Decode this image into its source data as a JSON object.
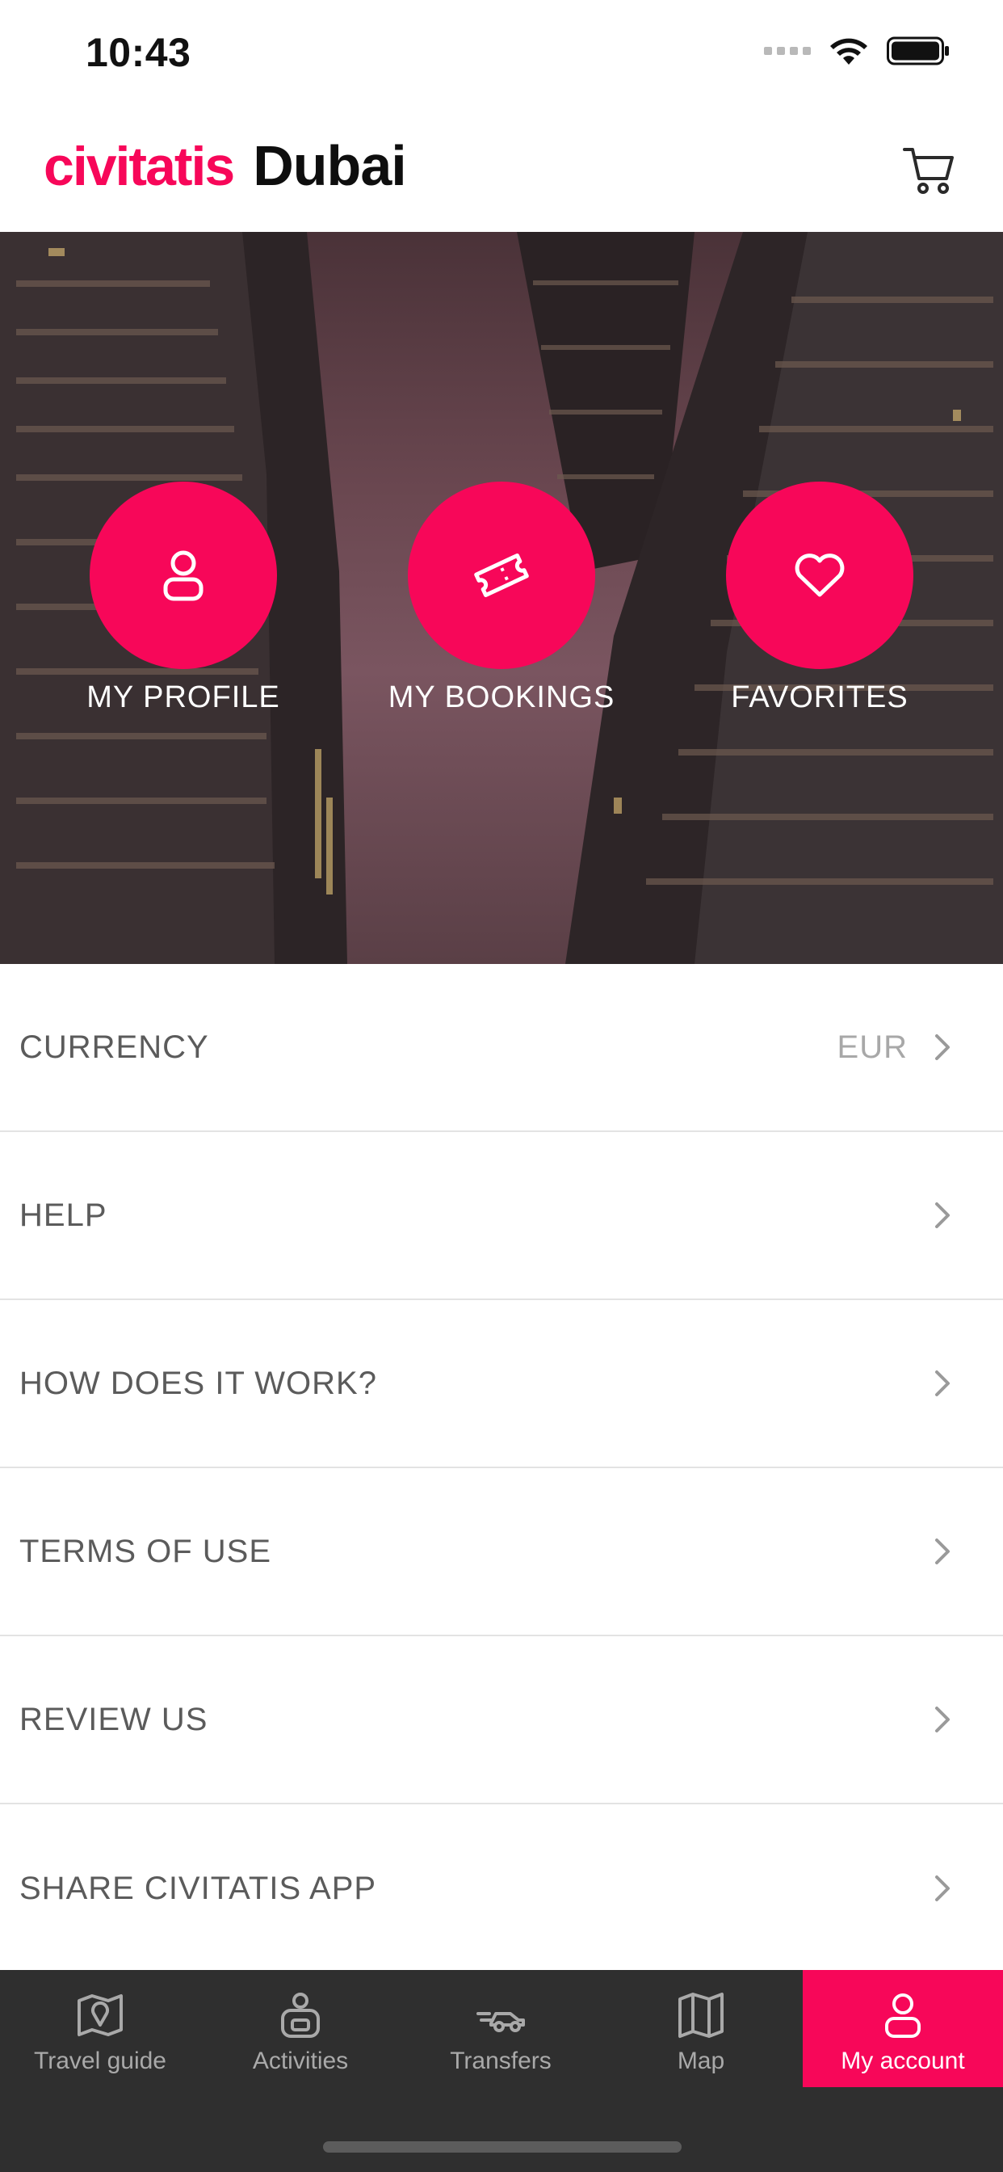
{
  "status_bar": {
    "time": "10:43"
  },
  "header": {
    "brand": "civitatis",
    "city": "Dubai"
  },
  "quick_actions": [
    {
      "label": "MY PROFILE",
      "icon": "user-icon"
    },
    {
      "label": "MY BOOKINGS",
      "icon": "ticket-icon"
    },
    {
      "label": "FAVORITES",
      "icon": "heart-icon"
    }
  ],
  "menu": [
    {
      "label": "CURRENCY",
      "value": "EUR"
    },
    {
      "label": "HELP"
    },
    {
      "label": "HOW DOES IT WORK?"
    },
    {
      "label": "TERMS OF USE"
    },
    {
      "label": "REVIEW US"
    },
    {
      "label": "SHARE CIVITATIS APP"
    }
  ],
  "tabs": [
    {
      "label": "Travel guide",
      "icon": "map-pin-icon"
    },
    {
      "label": "Activities",
      "icon": "activities-icon"
    },
    {
      "label": "Transfers",
      "icon": "car-icon"
    },
    {
      "label": "Map",
      "icon": "map-icon"
    },
    {
      "label": "My account",
      "icon": "user-icon",
      "active": true
    }
  ],
  "colors": {
    "accent": "#f70759",
    "tab_bar": "#2f2f2f"
  }
}
